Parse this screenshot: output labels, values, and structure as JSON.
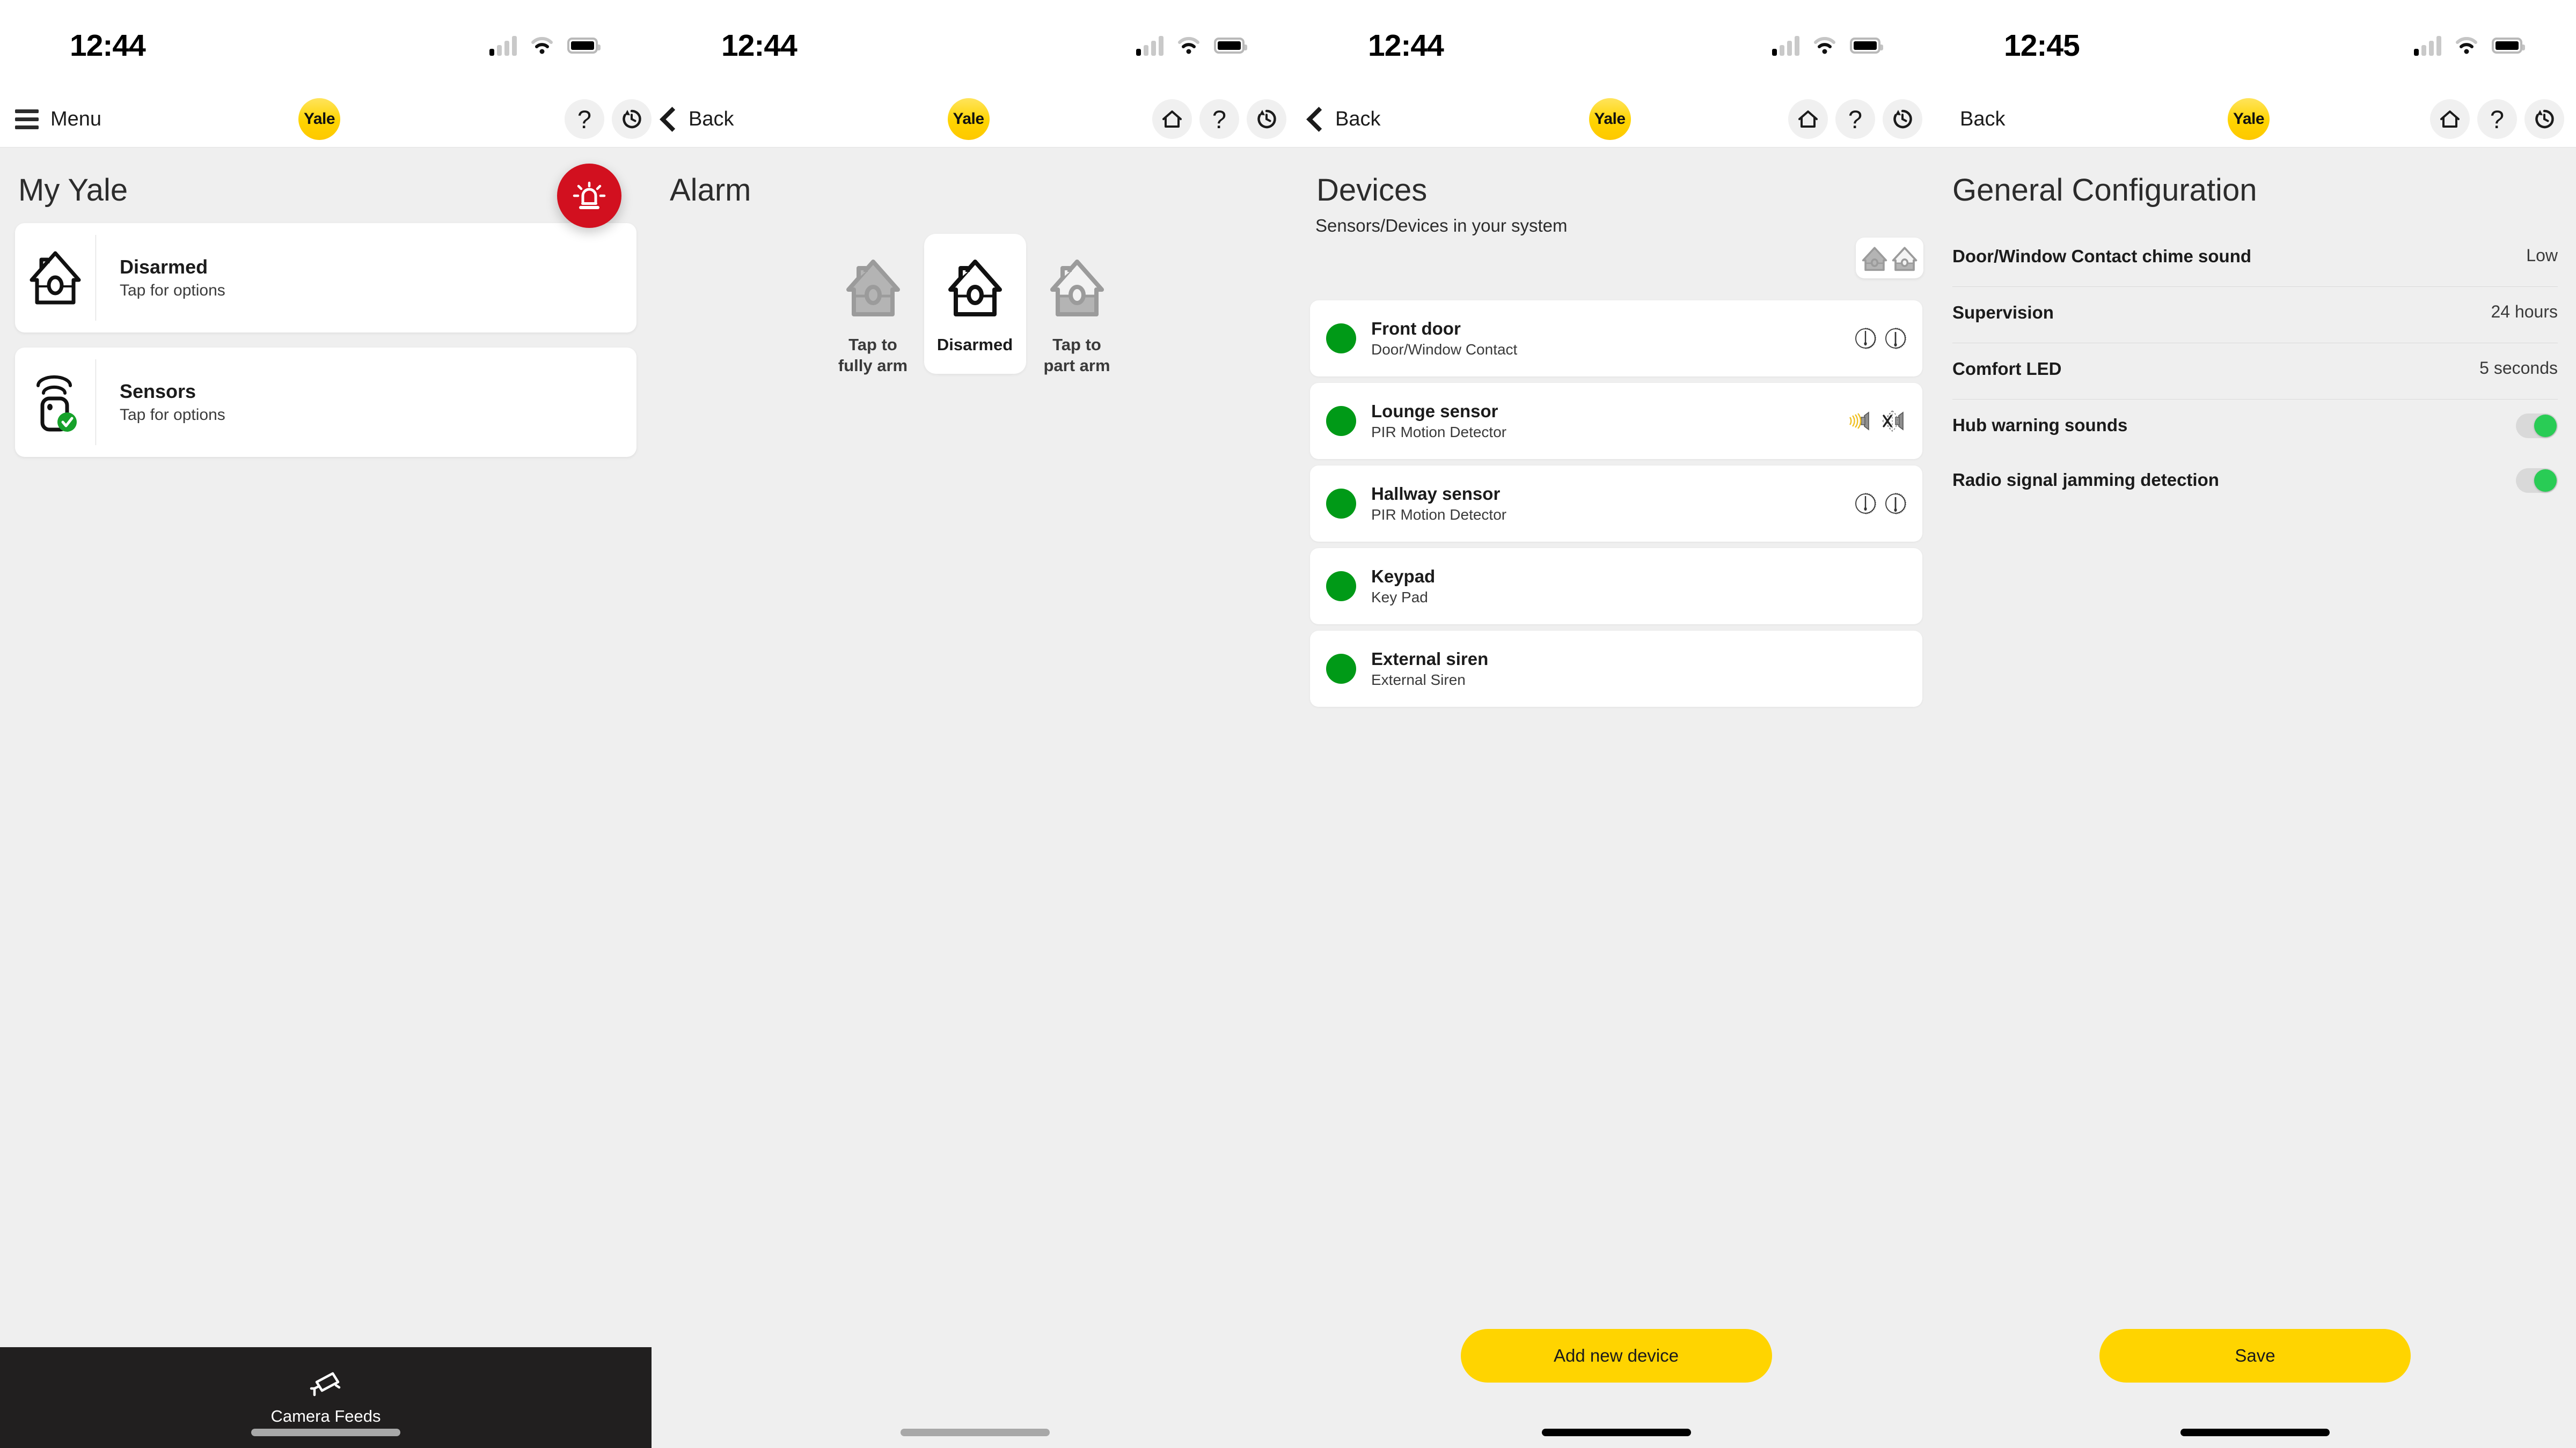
{
  "brand": {
    "logo_text": "Yale",
    "yellow": "#FFD400",
    "red": "#D2101F",
    "green": "#009A17",
    "toggle_green": "#29CC55"
  },
  "screens": [
    {
      "status": {
        "time": "12:44",
        "signal_icon": "cellular-signal-icon",
        "wifi_icon": "wifi-icon",
        "battery_icon": "battery-icon"
      },
      "nav": {
        "menu_label": "Menu",
        "menu_icon": "hamburger-icon",
        "help_icon": "help-icon",
        "history_icon": "history-icon"
      },
      "title": "My Yale",
      "panic": {
        "icon": "siren-icon"
      },
      "cards": [
        {
          "icon": "house-outline-icon",
          "title": "Disarmed",
          "subtitle": "Tap for options"
        },
        {
          "icon": "sensor-icon",
          "badge": "check-badge",
          "title": "Sensors",
          "subtitle": "Tap for options"
        }
      ],
      "camera_feeds": {
        "label": "Camera Feeds",
        "icon": "cctv-camera-icon"
      }
    },
    {
      "status": {
        "time": "12:44"
      },
      "nav": {
        "back_label": "Back",
        "home_icon": "home-icon",
        "help_icon": "help-icon",
        "history_icon": "history-icon"
      },
      "title": "Alarm",
      "arm_options": [
        {
          "label": "Tap to fully arm",
          "icon": "house-filled-icon",
          "state": "inactive"
        },
        {
          "label": "Disarmed",
          "icon": "house-outline-icon",
          "state": "selected"
        },
        {
          "label": "Tap to part arm",
          "icon": "house-part-icon",
          "state": "inactive"
        }
      ]
    },
    {
      "status": {
        "time": "12:44"
      },
      "nav": {
        "back_label": "Back",
        "home_icon": "home-icon",
        "help_icon": "help-icon",
        "history_icon": "history-icon"
      },
      "title": "Devices",
      "subtitle": "Sensors/Devices in your system",
      "mode_toggle": {
        "icon": "two-houses-icon"
      },
      "devices": [
        {
          "status": "online",
          "name": "Front door",
          "type": "Door/Window Contact",
          "icons": [
            "dial-left-icon",
            "dial-right-icon"
          ]
        },
        {
          "status": "online",
          "name": "Lounge sensor",
          "type": "PIR Motion Detector",
          "icons": [
            "sound-on-icon",
            "sound-off-icon"
          ]
        },
        {
          "status": "online",
          "name": "Hallway sensor",
          "type": "PIR Motion Detector",
          "icons": [
            "dial-left-icon",
            "dial-right-icon"
          ]
        },
        {
          "status": "online",
          "name": "Keypad",
          "type": "Key Pad",
          "icons": []
        },
        {
          "status": "online",
          "name": "External siren",
          "type": "External Siren",
          "icons": []
        }
      ],
      "primary_button": "Add new device"
    },
    {
      "status": {
        "time": "12:45"
      },
      "nav": {
        "back_label": "Back",
        "home_icon": "home-icon",
        "help_icon": "help-icon",
        "history_icon": "history-icon"
      },
      "title": "General Configuration",
      "settings": [
        {
          "label": "Door/Window Contact chime sound",
          "value": "Low",
          "control": "value"
        },
        {
          "label": "Supervision",
          "value": "24 hours",
          "control": "value"
        },
        {
          "label": "Comfort LED",
          "value": "5 seconds",
          "control": "value"
        },
        {
          "label": "Hub warning sounds",
          "value": "on",
          "control": "toggle"
        },
        {
          "label": "Radio signal jamming detection",
          "value": "on",
          "control": "toggle"
        }
      ],
      "primary_button": "Save"
    }
  ]
}
